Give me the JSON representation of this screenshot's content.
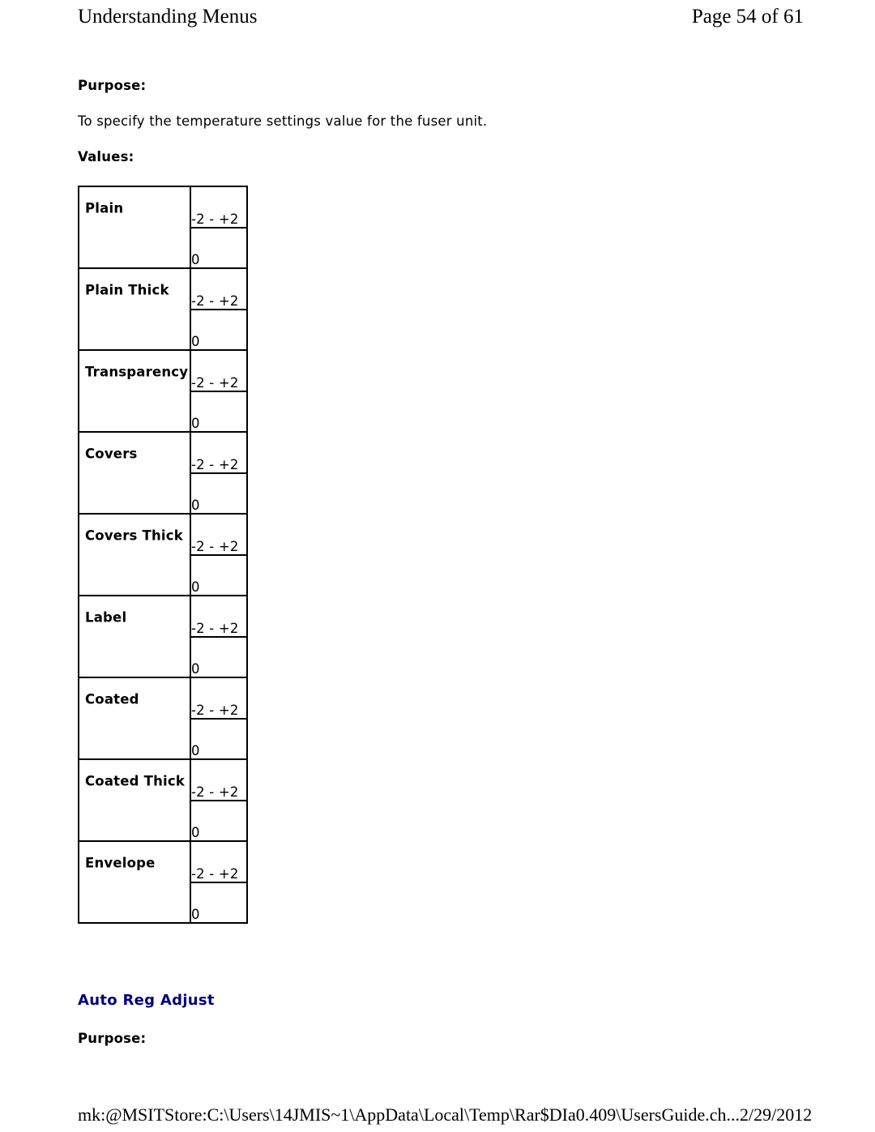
{
  "header": {
    "left_title": "Understanding Menus",
    "right_pageinfo": "Page 54 of 61"
  },
  "body": {
    "purpose_label": "Purpose:",
    "purpose_text": "To specify the temperature settings value for the fuser unit.",
    "values_label": "Values:"
  },
  "values_table": {
    "rows": [
      {
        "material": "Plain",
        "range": "-2 - +2",
        "default": "0"
      },
      {
        "material": "Plain Thick",
        "range": "-2 - +2",
        "default": "0"
      },
      {
        "material": "Transparency",
        "range": "-2 - +2",
        "default": "0"
      },
      {
        "material": "Covers",
        "range": "-2 - +2",
        "default": "0"
      },
      {
        "material": "Covers Thick",
        "range": "-2 - +2",
        "default": "0"
      },
      {
        "material": "Label",
        "range": "-2 - +2",
        "default": "0"
      },
      {
        "material": "Coated",
        "range": "-2 - +2",
        "default": "0"
      },
      {
        "material": "Coated Thick",
        "range": "-2 - +2",
        "default": "0"
      },
      {
        "material": "Envelope",
        "range": "-2 - +2",
        "default": "0"
      }
    ]
  },
  "next_section": {
    "heading": "Auto Reg Adjust",
    "heading_color": "#00007f",
    "purpose_label": "Purpose:"
  },
  "footer": {
    "path": "mk:@MSITStore:C:\\Users\\14JMIS~1\\AppData\\Local\\Temp\\Rar$DIa0.409\\UsersGuide.ch...",
    "date": "2/29/2012"
  }
}
